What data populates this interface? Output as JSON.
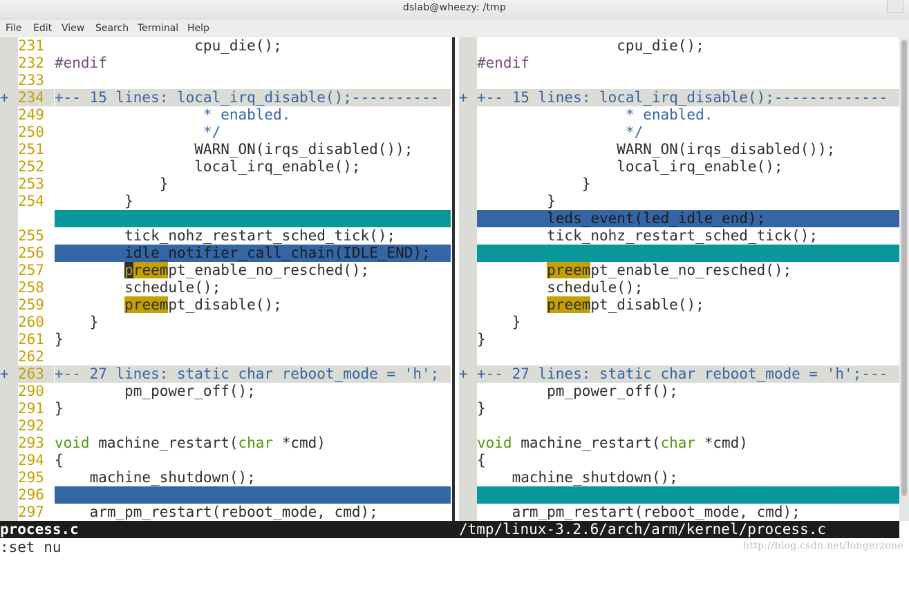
{
  "window": {
    "title": "dslab@wheezy: /tmp"
  },
  "menu": [
    "File",
    "Edit",
    "View",
    "Search",
    "Terminal",
    "Help"
  ],
  "left_pane": [
    {
      "num": "231",
      "text": "                cpu_die();"
    },
    {
      "num": "232",
      "text": "#endif",
      "cls": "pre"
    },
    {
      "num": "233",
      "text": ""
    },
    {
      "num": "234",
      "text": "+-- 15 lines: local_irq_disable();----------",
      "kind": "fold",
      "gutter": "+"
    },
    {
      "num": "249",
      "text": "                 * enabled.",
      "cls": "cmt"
    },
    {
      "num": "250",
      "text": "                 */",
      "cls": "cmt"
    },
    {
      "num": "251",
      "text": "                WARN_ON(irqs_disabled());"
    },
    {
      "num": "252",
      "text": "                local_irq_enable();"
    },
    {
      "num": "253",
      "text": "            }"
    },
    {
      "num": "254",
      "text": "        }"
    },
    {
      "num": "",
      "text": "---------------------------------------------",
      "kind": "del"
    },
    {
      "num": "255",
      "text": "        tick_nohz_restart_sched_tick();"
    },
    {
      "num": "256",
      "text": "        idle_notifier_call_chain(IDLE_END);",
      "kind": "add"
    },
    {
      "num": "257",
      "text": "preempt_enable_no_resched();",
      "lead": "        ",
      "mark": "cursor"
    },
    {
      "num": "258",
      "text": "        schedule();"
    },
    {
      "num": "259",
      "text": "preempt_disable();",
      "lead": "        ",
      "mark": "hl"
    },
    {
      "num": "260",
      "text": "    }"
    },
    {
      "num": "261",
      "text": "}"
    },
    {
      "num": "262",
      "text": ""
    },
    {
      "num": "263",
      "text": "+-- 27 lines: static char reboot_mode = 'h';",
      "kind": "fold",
      "gutter": "+"
    },
    {
      "num": "290",
      "text": "        pm_power_off();"
    },
    {
      "num": "291",
      "text": "}"
    },
    {
      "num": "292",
      "text": ""
    },
    {
      "num": "293",
      "text": "void machine_restart(char *cmd)",
      "mark": "sig"
    },
    {
      "num": "294",
      "text": "{"
    },
    {
      "num": "295",
      "text": "    machine_shutdown();"
    },
    {
      "num": "296",
      "text": "",
      "kind": "add"
    },
    {
      "num": "297",
      "text": "    arm_pm_restart(reboot_mode, cmd);"
    }
  ],
  "right_pane": [
    {
      "text": "                cpu_die();"
    },
    {
      "text": "#endif",
      "cls": "pre"
    },
    {
      "text": ""
    },
    {
      "text": "+-- 15 lines: local_irq_disable();-------------",
      "kind": "fold",
      "gutter": "+"
    },
    {
      "text": "                 * enabled.",
      "cls": "cmt"
    },
    {
      "text": "                 */",
      "cls": "cmt"
    },
    {
      "text": "                WARN_ON(irqs_disabled());"
    },
    {
      "text": "                local_irq_enable();"
    },
    {
      "text": "            }"
    },
    {
      "text": "        }"
    },
    {
      "text": "        leds_event(led_idle_end);",
      "kind": "add"
    },
    {
      "text": "        tick_nohz_restart_sched_tick();"
    },
    {
      "text": "---------------------------------------------",
      "kind": "del"
    },
    {
      "text": "preempt_enable_no_resched();",
      "lead": "        ",
      "mark": "hl"
    },
    {
      "text": "        schedule();"
    },
    {
      "text": "preempt_disable();",
      "lead": "        ",
      "mark": "hl"
    },
    {
      "text": "    }"
    },
    {
      "text": "}"
    },
    {
      "text": ""
    },
    {
      "text": "+-- 27 lines: static char reboot_mode = 'h';---",
      "kind": "fold",
      "gutter": "+"
    },
    {
      "text": "        pm_power_off();"
    },
    {
      "text": "}"
    },
    {
      "text": ""
    },
    {
      "text": "void machine_restart(char *cmd)",
      "mark": "sig"
    },
    {
      "text": "{"
    },
    {
      "text": "    machine_shutdown();"
    },
    {
      "text": "---------------------------------------------",
      "kind": "del"
    },
    {
      "text": "    arm_pm_restart(reboot_mode, cmd);"
    }
  ],
  "status": {
    "left": "process.c",
    "right": "/tmp/linux-3.2.6/arch/arm/kernel/process.c"
  },
  "cmdline": ":set nu",
  "watermark": "http://blog.csdn.net/longerzone",
  "colors": {
    "fold_bg": "#dcdcd6",
    "added_bg": "#3465a4",
    "deleted_bg": "#06989a",
    "line_number": "#c4a000",
    "search_highlight": "#c4a000"
  }
}
